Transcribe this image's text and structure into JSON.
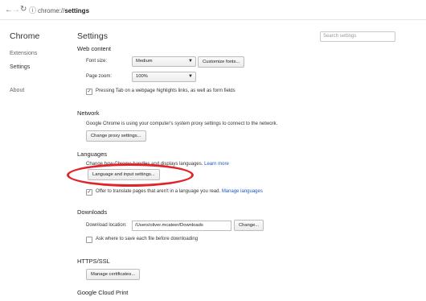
{
  "browser": {
    "url_prefix": "chrome://",
    "url_bold": "settings"
  },
  "sidebar": {
    "heading": "Chrome",
    "items": [
      "Extensions",
      "Settings",
      "About"
    ]
  },
  "header": {
    "title": "Settings",
    "search_placeholder": "Search settings"
  },
  "web_content": {
    "heading": "Web content",
    "font_size_label": "Font size:",
    "font_size_value": "Medium",
    "customize_fonts": "Customize fonts...",
    "page_zoom_label": "Page zoom:",
    "page_zoom_value": "100%",
    "tab_highlight": "Pressing Tab on a webpage highlights links, as well as form fields"
  },
  "network": {
    "heading": "Network",
    "text": "Google Chrome is using your computer's system proxy settings to connect to the network.",
    "button": "Change proxy settings..."
  },
  "languages": {
    "heading": "Languages",
    "text": "Change how Chrome handles and displays languages.",
    "learn_more": "Learn more",
    "button": "Language and input settings...",
    "offer_translate": "Offer to translate pages that aren't in a language you read.",
    "manage": "Manage languages"
  },
  "downloads": {
    "heading": "Downloads",
    "location_label": "Download location:",
    "location_value": "/Users/oliver.mcateer/Downloads",
    "change_button": "Change...",
    "ask_where": "Ask where to save each file before downloading"
  },
  "https": {
    "heading": "HTTPS/SSL",
    "button": "Manage certificates..."
  },
  "cloud_print": {
    "heading": "Google Cloud Print"
  },
  "colors": {
    "link": "#1a56c5",
    "annotation": "#e0242b"
  }
}
